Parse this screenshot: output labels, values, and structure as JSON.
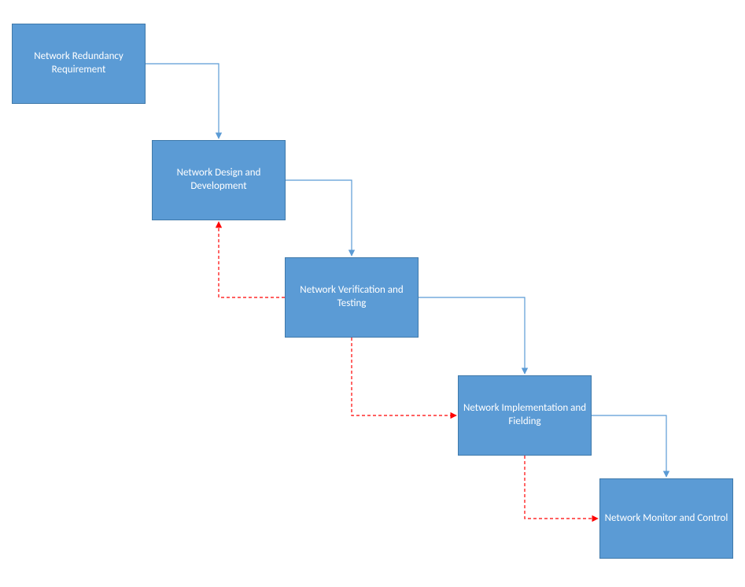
{
  "diagram": {
    "type": "flowchart",
    "boxes": [
      {
        "id": "req",
        "label": "Network Redundancy Requirement"
      },
      {
        "id": "design",
        "label": "Network Design and Development"
      },
      {
        "id": "verify",
        "label": "Network Verification and Testing"
      },
      {
        "id": "impl",
        "label": "Network Implementation and Fielding"
      },
      {
        "id": "monitor",
        "label": "Network Monitor and Control"
      }
    ],
    "forward_arrows": [
      {
        "from": "req",
        "to": "design"
      },
      {
        "from": "design",
        "to": "verify"
      },
      {
        "from": "verify",
        "to": "impl"
      },
      {
        "from": "impl",
        "to": "monitor"
      }
    ],
    "feedback_arrows": [
      {
        "from": "verify",
        "to": "design",
        "style": "dashed-red"
      },
      {
        "from": "verify",
        "to": "impl",
        "style": "dashed-red"
      },
      {
        "from": "impl",
        "to": "monitor",
        "style": "dashed-red"
      }
    ],
    "colors": {
      "box_fill": "#5b9bd5",
      "box_border": "#3f79aa",
      "forward_arrow": "#5b9bd5",
      "feedback_arrow": "#ff0000"
    }
  }
}
